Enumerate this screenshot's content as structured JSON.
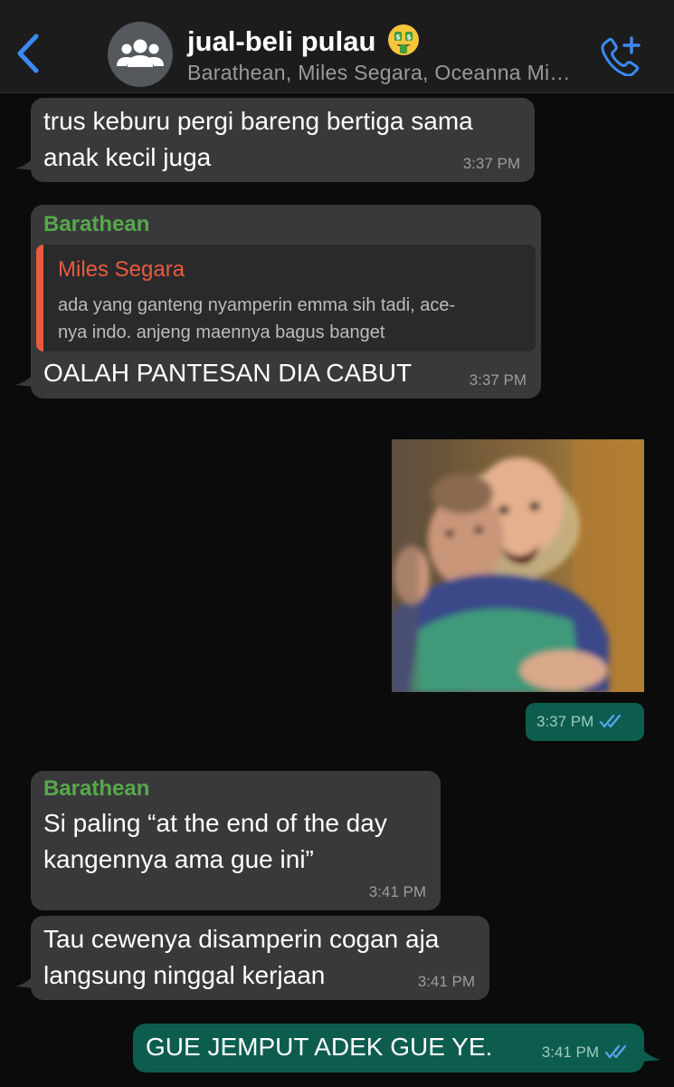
{
  "header": {
    "title": "jual-beli pulau",
    "subtitle": "Barathean, Miles Segara, Oceanna Mi…",
    "back_icon": "chevron-left-icon",
    "call_icon": "phone-plus-icon",
    "avatar_icon": "group-icon",
    "title_emoji": "money-mouth-face-emoji"
  },
  "colors": {
    "accent": "#3a8bf5",
    "incoming_bubble": "#39393b",
    "outgoing_bubble": "#0d5d4f",
    "sender_name": "#57a84a",
    "quote_author": "#ea5a3c"
  },
  "messages": [
    {
      "direction": "in",
      "lines": [
        "trus keburu pergi bareng bertiga sama",
        "anak kecil juga"
      ],
      "time": "3:37 PM"
    },
    {
      "direction": "in",
      "sender": "Barathean",
      "quote": {
        "author": "Miles Segara",
        "lines": [
          "ada yang ganteng nyamperin emma sih tadi, ace-",
          "nya indo. anjeng maennya bagus banget"
        ]
      },
      "lines": [
        "OALAH PANTESAN DIA CABUT"
      ],
      "time": "3:37 PM"
    },
    {
      "direction": "out",
      "type": "image",
      "image": "photo of two toddlers",
      "time": "3:37 PM",
      "status": "read"
    },
    {
      "direction": "in",
      "sender": "Barathean",
      "lines": [
        "Si paling “at the end of the day",
        "kangennya ama gue ini”"
      ],
      "time": "3:41 PM"
    },
    {
      "direction": "in",
      "lines": [
        "Tau cewenya disamperin cogan aja",
        "langsung ninggal kerjaan"
      ],
      "time": "3:41 PM"
    },
    {
      "direction": "out",
      "lines": [
        "GUE JEMPUT ADEK GUE YE."
      ],
      "time": "3:41 PM",
      "status": "read"
    }
  ]
}
